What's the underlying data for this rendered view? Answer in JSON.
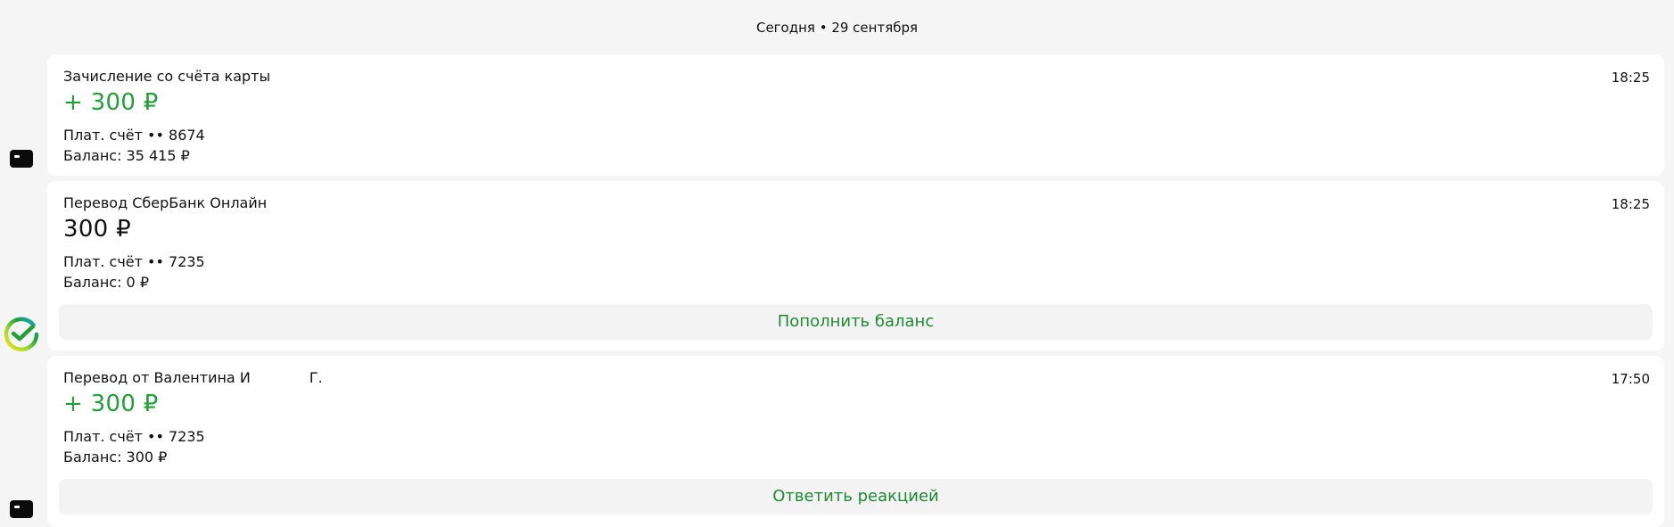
{
  "date_header": "Сегодня • 29 сентября",
  "operations": [
    {
      "title": "Зачисление со счёта карты",
      "time": "18:25",
      "amount": "+ 300 ₽",
      "account": "Плат. счёт •• 8674",
      "balance": "Баланс: 35 415 ₽"
    },
    {
      "title": "Перевод СберБанк Онлайн",
      "time": "18:25",
      "amount": "300 ₽",
      "account": "Плат. счёт •• 7235",
      "balance": "Баланс: 0 ₽",
      "action": "Пополнить баланс"
    },
    {
      "title": "Перевод от Валентина И             Г.",
      "time": "17:50",
      "amount": "+ 300 ₽",
      "account": "Плат. счёт •• 7235",
      "balance": "Баланс: 300 ₽",
      "action": "Ответить реакцией"
    }
  ],
  "icons": {
    "card": "bank-card-icon",
    "sber": "sber-logo-icon"
  },
  "colors": {
    "income_green": "#21a038",
    "action_green": "#1d8a34",
    "background": "#f5f5f5",
    "card_bg": "#ffffff"
  }
}
